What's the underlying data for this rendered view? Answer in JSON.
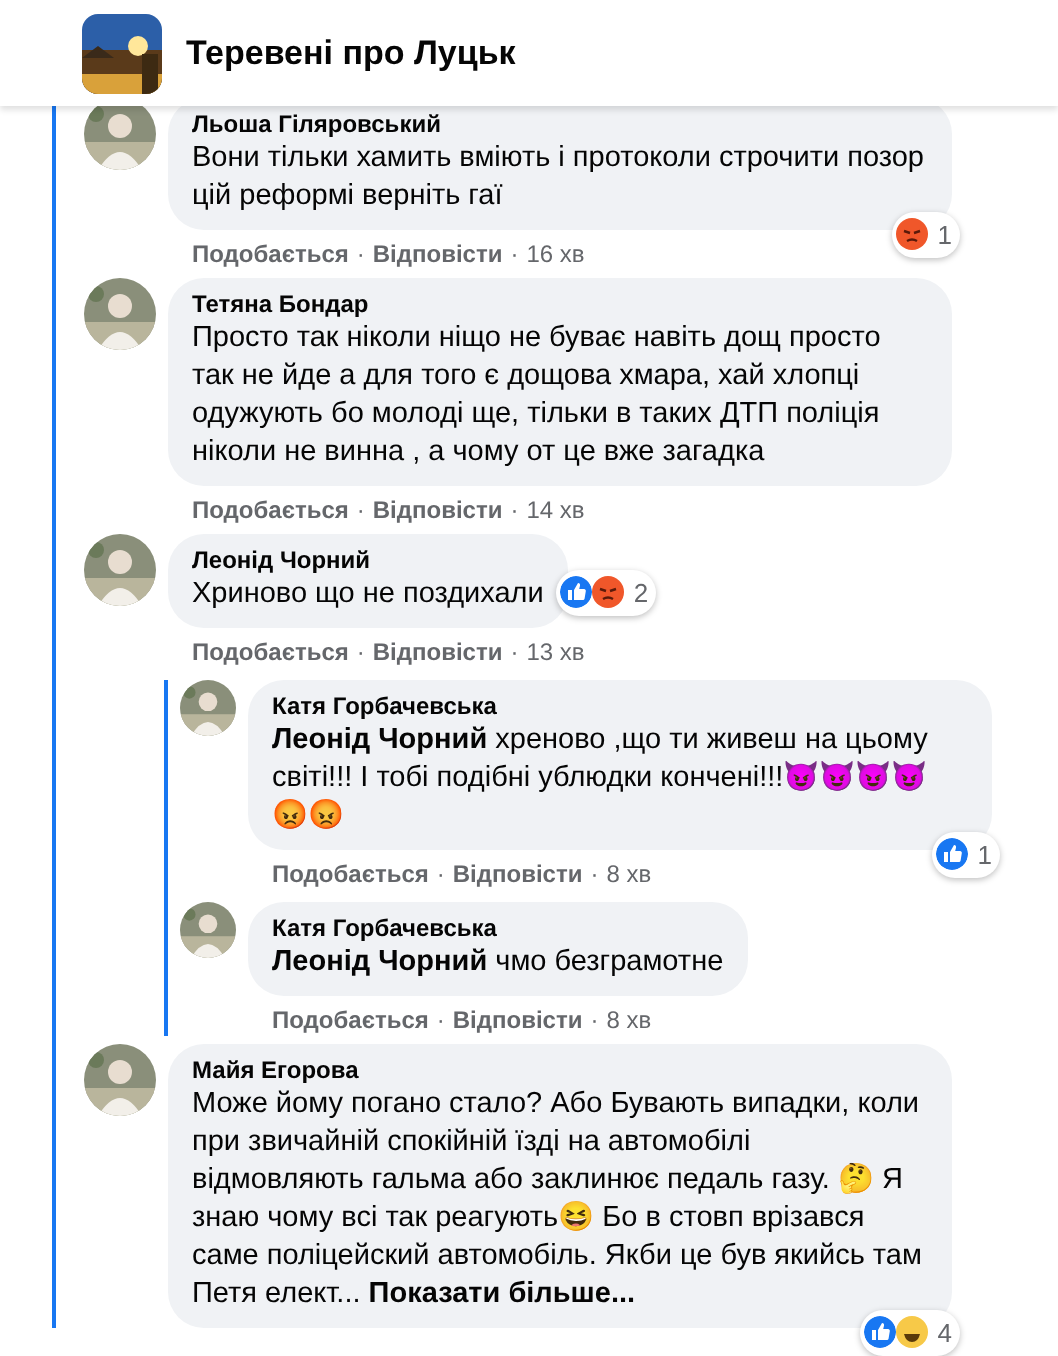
{
  "header": {
    "title": "Теревені про Луцьк"
  },
  "comments": [
    {
      "author": "Льоша Гіляровський",
      "text": "Вони тільки хамить вміють і протоколи строчити позор цій реформі верніть гаї",
      "reactions": {
        "icons": [
          {
            "kind": "angry"
          }
        ],
        "count": "1"
      },
      "meta": [
        {
          "kind": "like",
          "text": "Подобається"
        },
        {
          "kind": "dot",
          "text": "·"
        },
        {
          "kind": "reply",
          "text": "Відповісти"
        },
        {
          "kind": "dot",
          "text": "·"
        },
        {
          "kind": "time",
          "text": "16 хв"
        }
      ]
    },
    {
      "author": "Тетяна Бондар",
      "text": "Просто так ніколи ніщо не буває навіть дощ просто так не йде а для того є дощова хмара, хай хлопці одужують бо молоді ще, тільки в таких ДТП поліція ніколи не винна , а чому от це вже загадка",
      "meta": [
        {
          "kind": "like",
          "text": "Подобається"
        },
        {
          "kind": "dot",
          "text": "·"
        },
        {
          "kind": "reply",
          "text": "Відповісти"
        },
        {
          "kind": "dot",
          "text": "·"
        },
        {
          "kind": "time",
          "text": "14 хв"
        }
      ]
    },
    {
      "author": "Леонід Чорний",
      "text": "Хриново що не поздихали",
      "reactions": {
        "icons": [
          {
            "kind": "like"
          },
          {
            "kind": "angry"
          }
        ],
        "count": "2"
      },
      "meta": [
        {
          "kind": "like",
          "text": "Подобається"
        },
        {
          "kind": "dot",
          "text": "·"
        },
        {
          "kind": "reply",
          "text": "Відповісти"
        },
        {
          "kind": "dot",
          "text": "·"
        },
        {
          "kind": "time",
          "text": "13 хв"
        }
      ],
      "replies": [
        {
          "author": "Катя Горбачевська",
          "text": "**Леонід Чорний** хреново ,що ти живеш на цьому світі!!! І тобі подібні ублюдки кончені!!!😈😈😈😈 😡😡",
          "reactions": {
            "icons": [
              {
                "kind": "like"
              }
            ],
            "count": "1"
          },
          "meta": [
            {
              "kind": "like",
              "text": "Подобається"
            },
            {
              "kind": "dot",
              "text": "·"
            },
            {
              "kind": "reply",
              "text": "Відповісти"
            },
            {
              "kind": "dot",
              "text": "·"
            },
            {
              "kind": "time",
              "text": "8 хв"
            }
          ]
        },
        {
          "author": "Катя Горбачевська",
          "text": "**Леонід Чорний** чмо безграмотне",
          "meta": [
            {
              "kind": "like",
              "text": "Подобається"
            },
            {
              "kind": "dot",
              "text": "·"
            },
            {
              "kind": "reply",
              "text": "Відповісти"
            },
            {
              "kind": "dot",
              "text": "·"
            },
            {
              "kind": "time",
              "text": "8 хв"
            }
          ]
        }
      ]
    },
    {
      "author": "Майя Егорова",
      "text": "Може йому погано стало? Або Бувають випадки, коли при звичайній спокійній їзді на автомобілі відмовляють гальма або заклинює педаль газу. 🤔 Я знаю чому всі так реагують😆 Бо в стовп врізався саме поліцейский автомобіль. Якби це був якийсь там Петя елект...",
      "see_more": "Показати більше...",
      "reactions": {
        "icons": [
          {
            "kind": "like"
          },
          {
            "kind": "haha"
          }
        ],
        "count": "4"
      }
    }
  ]
}
